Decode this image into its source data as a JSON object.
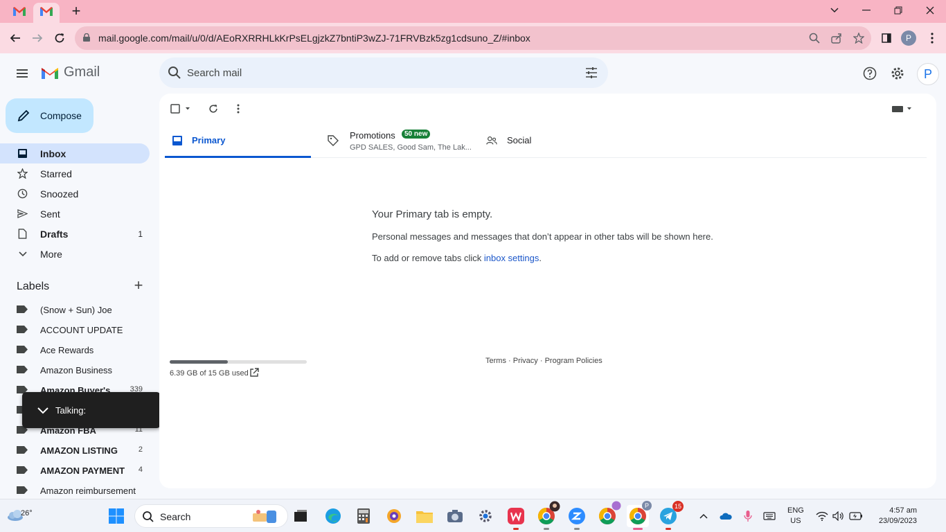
{
  "browser": {
    "tabs": [
      {
        "icon": "gmail-favicon"
      },
      {
        "icon": "gmail-favicon"
      }
    ],
    "new_tab": "+",
    "url": "mail.google.com/mail/u/0/d/AEoRXRRHLkKrPsELgjzkZ7bntiP3wZJ-71FRVBzk5zg1cdsuno_Z/#inbox",
    "profile_initial": "P"
  },
  "gmail": {
    "logo_text": "Gmail",
    "search_placeholder": "Search mail",
    "account_initial": "P",
    "compose_label": "Compose"
  },
  "nav": [
    {
      "label": "Inbox",
      "icon": "inbox-icon",
      "count": "",
      "active": true
    },
    {
      "label": "Starred",
      "icon": "star-icon",
      "count": ""
    },
    {
      "label": "Snoozed",
      "icon": "clock-icon",
      "count": ""
    },
    {
      "label": "Sent",
      "icon": "send-icon",
      "count": ""
    },
    {
      "label": "Drafts",
      "icon": "draft-icon",
      "count": "1"
    },
    {
      "label": "More",
      "icon": "chevron-down-icon",
      "count": ""
    }
  ],
  "labels_heading": "Labels",
  "labels": [
    {
      "label": "(Snow + Sun) Joe",
      "count": ""
    },
    {
      "label": "ACCOUNT UPDATE",
      "count": ""
    },
    {
      "label": "Ace Rewards",
      "count": ""
    },
    {
      "label": "Amazon Business",
      "count": ""
    },
    {
      "label": "Amazon Buyer's",
      "count": "339"
    },
    {
      "label": "",
      "count": ""
    },
    {
      "label": "Amazon FBA",
      "count": "11"
    },
    {
      "label": "AMAZON LISTING",
      "count": "2"
    },
    {
      "label": "AMAZON PAYMENT",
      "count": "4"
    },
    {
      "label": "Amazon reimbursement",
      "count": ""
    }
  ],
  "talking_popup": "Talking:",
  "category_tabs": {
    "primary": "Primary",
    "promotions": "Promotions",
    "promotions_badge": "50 new",
    "promotions_senders": "GPD SALES, Good Sam, The Lak...",
    "social": "Social"
  },
  "empty_state": {
    "title": "Your Primary tab is empty.",
    "description": "Personal messages and messages that don’t appear in other tabs will be shown here.",
    "hint_prefix": "To add or remove tabs click ",
    "hint_link": "inbox settings",
    "hint_suffix": "."
  },
  "storage": {
    "text": "6.39 GB of 15 GB used",
    "used_fraction": 0.426
  },
  "footer": {
    "terms": "Terms",
    "sep1": " · ",
    "privacy": "Privacy",
    "sep2": " · ",
    "policies": "Program Policies"
  },
  "taskbar": {
    "temperature": "26°",
    "search_label": "Search",
    "telegram_badge": "15",
    "chrome_profile_badge": "P",
    "language_line1": "ENG",
    "language_line2": "US",
    "time": "4:57 am",
    "date": "23/09/2023"
  },
  "colors": {
    "accent": "#0b57d0",
    "compose_bg": "#c2e7ff",
    "active_nav": "#d3e3fd",
    "tab_strip": "#f8b4c4",
    "badge_green": "#188038"
  }
}
